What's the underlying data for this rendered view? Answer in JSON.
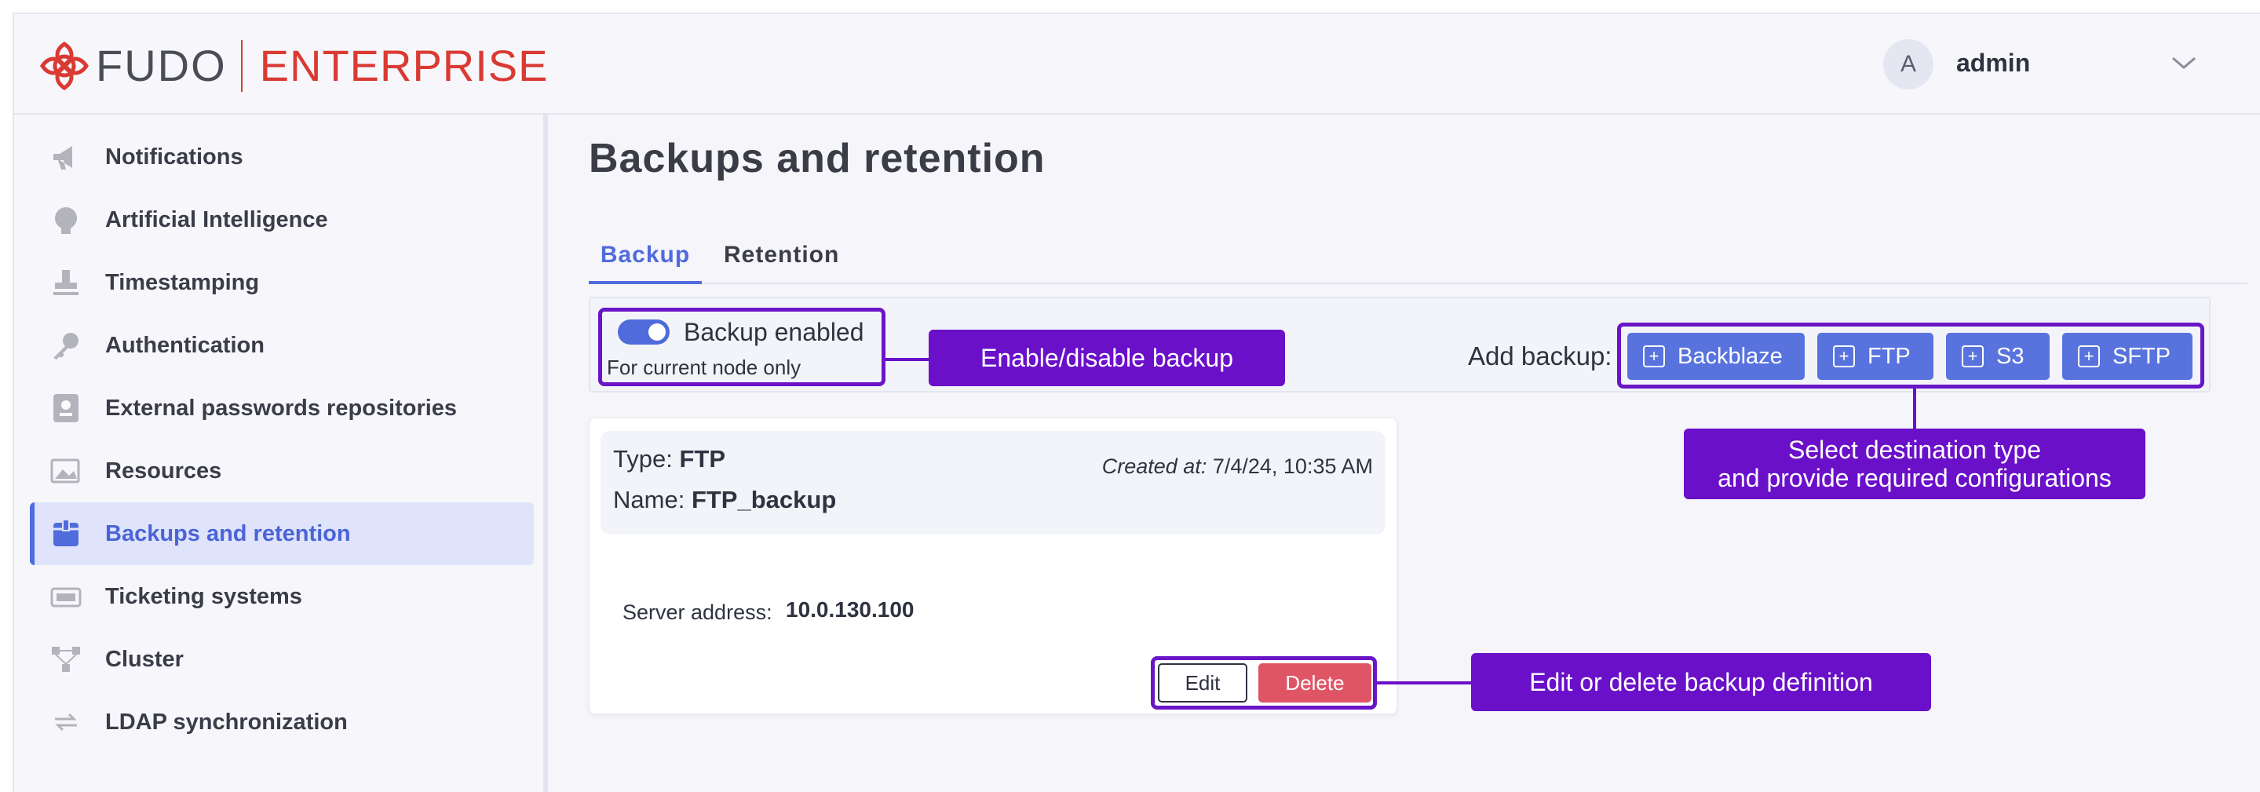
{
  "header": {
    "logo_text_left": "FUDO",
    "logo_text_right": "ENTERPRISE",
    "user_avatar": "A",
    "user_name": "admin"
  },
  "sidebar": {
    "items": [
      {
        "label": "Notifications",
        "icon": "megaphone-icon"
      },
      {
        "label": "Artificial Intelligence",
        "icon": "brain-icon"
      },
      {
        "label": "Timestamping",
        "icon": "stamp-icon"
      },
      {
        "label": "Authentication",
        "icon": "key-icon"
      },
      {
        "label": "External passwords repositories",
        "icon": "vault-icon"
      },
      {
        "label": "Resources",
        "icon": "image-icon"
      },
      {
        "label": "Backups and retention",
        "icon": "archive-icon",
        "active": true
      },
      {
        "label": "Ticketing systems",
        "icon": "ticket-icon"
      },
      {
        "label": "Cluster",
        "icon": "cluster-icon"
      },
      {
        "label": "LDAP synchronization",
        "icon": "sync-icon"
      }
    ]
  },
  "main": {
    "title": "Backups and retention",
    "tabs": [
      {
        "label": "Backup",
        "active": true
      },
      {
        "label": "Retention"
      }
    ],
    "toggle": {
      "label": "Backup enabled",
      "sublabel": "For current node only",
      "enabled": true
    },
    "add_backup": {
      "label": "Add backup:",
      "buttons": [
        "Backblaze",
        "FTP",
        "S3",
        "SFTP"
      ]
    },
    "card": {
      "type_label": "Type:",
      "type_value": "FTP",
      "name_label": "Name:",
      "name_value": "FTP_backup",
      "created_label": "Created at:",
      "created_value": "7/4/24, 10:35 AM",
      "server_label": "Server address:",
      "server_value": "10.0.130.100",
      "edit_label": "Edit",
      "delete_label": "Delete"
    }
  },
  "annotations": {
    "toggle": "Enable/disable backup",
    "destination_line1": "Select destination type",
    "destination_line2": "and provide required configurations",
    "actions": "Edit or delete backup definition"
  },
  "colors": {
    "accent": "#4f6bdc",
    "annotation": "#6a10c9",
    "brand": "#d93a33",
    "danger": "#e05566"
  }
}
